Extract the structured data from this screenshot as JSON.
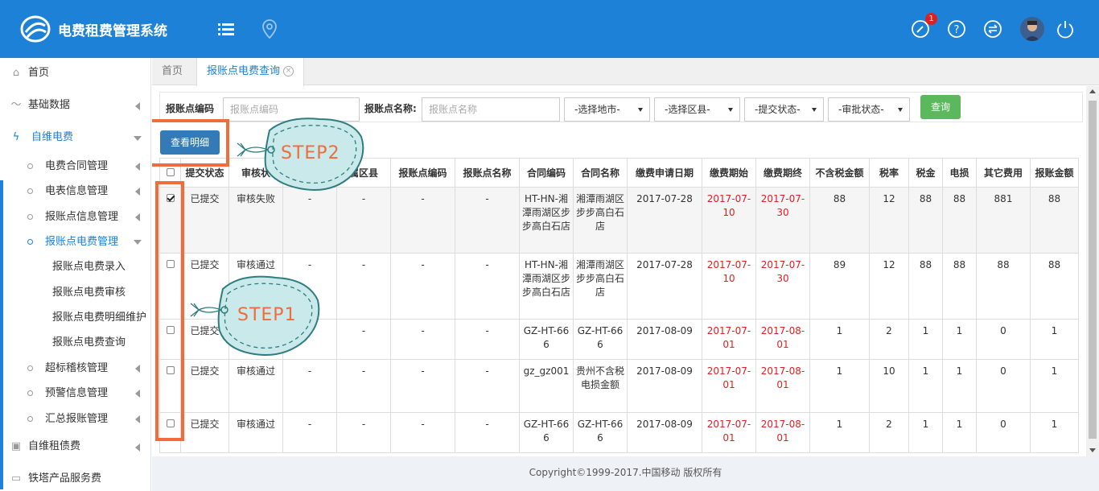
{
  "header": {
    "app_title": "电费租费管理系统",
    "notification_count": "1",
    "colors": {
      "bar": "#1c81d7",
      "accent": "#f26b3a",
      "badge": "#e02020"
    }
  },
  "sidebar": {
    "home": "首页",
    "basic_data": "基础数据",
    "self_maintained_power": "自维电费",
    "power_contract": "电费合同管理",
    "meter_info": "电表信息管理",
    "reimb_point_info": "报账点信息管理",
    "reimb_point_power": "报账点电费管理",
    "power_entry": "报账点电费录入",
    "power_audit": "报账点电费审核",
    "power_detail_maint": "报账点电费明细维护",
    "power_query": "报账点电费查询",
    "over_standard": "超标稽核管理",
    "warning_info": "预警信息管理",
    "summary_reimb": "汇总报账管理",
    "self_maintained_lease": "自维租债费",
    "tower_service_fee": "铁塔产品服务费"
  },
  "tabs": {
    "home": "首页",
    "active": "报账点电费查询"
  },
  "filter": {
    "code_label": "报账点编码",
    "code_placeholder": "报账点编码",
    "name_label": "报账点名称:",
    "name_placeholder": "报账点名称",
    "city_select": "-选择地市-",
    "district_select": "-选择区县-",
    "submit_status_select": "-提交状态-",
    "approval_status_select": "-审批状态-",
    "query_button": "查询"
  },
  "toolbar": {
    "detail_button": "查看明细"
  },
  "annotations": {
    "step1": "STEP1",
    "step2": "STEP2"
  },
  "table": {
    "columns": [
      "",
      "提交状态",
      "审核状",
      "属区县",
      "报账点编码",
      "报账点名称",
      "合同编码",
      "合同名称",
      "缴费申请日期",
      "缴费期始",
      "缴费期终",
      "不含税金额",
      "税率",
      "税金",
      "电损",
      "其它费用",
      "报账金额"
    ],
    "rows": [
      {
        "checked": true,
        "submit": "已提交",
        "audit": "审核失败",
        "c1": "-",
        "district": "-",
        "code": "-",
        "name": "-",
        "contract_code": "HT-HN-湘潭雨湖区步步高白石店",
        "contract_name": "湘潭雨湖区步步高白石店",
        "apply_date": "2017-07-28",
        "start": "2017-07-10",
        "end": "2017-07-30",
        "pretax": "88",
        "tax_rate": "12",
        "tax": "88",
        "loss": "88",
        "other": "881",
        "amount": "88"
      },
      {
        "checked": false,
        "submit": "已提交",
        "audit": "审核通过",
        "c1": "-",
        "district": "-",
        "code": "-",
        "name": "-",
        "contract_code": "HT-HN-湘潭雨湖区步步高白石店",
        "contract_name": "湘潭雨湖区步步高白石店",
        "apply_date": "2017-07-28",
        "start": "2017-07-10",
        "end": "2017-07-30",
        "pretax": "89",
        "tax_rate": "12",
        "tax": "88",
        "loss": "88",
        "other": "88",
        "amount": "88"
      },
      {
        "checked": false,
        "submit": "已提交",
        "audit": "",
        "c1": "-",
        "district": "-",
        "code": "-",
        "name": "-",
        "contract_code": "GZ-HT-666",
        "contract_name": "GZ-HT-666",
        "apply_date": "2017-08-09",
        "start": "2017-07-01",
        "end": "2017-08-01",
        "pretax": "1",
        "tax_rate": "2",
        "tax": "1",
        "loss": "1",
        "other": "0",
        "amount": "1"
      },
      {
        "checked": false,
        "submit": "已提交",
        "audit": "审核通过",
        "c1": "-",
        "district": "-",
        "code": "-",
        "name": "-",
        "contract_code": "gz_gz001",
        "contract_name": "贵州不含税电损金额",
        "apply_date": "2017-08-09",
        "start": "2017-07-01",
        "end": "2017-08-01",
        "pretax": "1",
        "tax_rate": "10",
        "tax": "1",
        "loss": "1",
        "other": "0",
        "amount": "1"
      },
      {
        "checked": false,
        "submit": "已提交",
        "audit": "审核通过",
        "c1": "-",
        "district": "-",
        "code": "-",
        "name": "-",
        "contract_code": "GZ-HT-666",
        "contract_name": "GZ-HT-666",
        "apply_date": "2017-08-09",
        "start": "2017-07-01",
        "end": "2017-08-01",
        "pretax": "1",
        "tax_rate": "2",
        "tax": "1",
        "loss": "1",
        "other": "0",
        "amount": "1"
      }
    ]
  },
  "footer": {
    "copyright": "Copyright©1999-2017.中国移动 版权所有"
  }
}
